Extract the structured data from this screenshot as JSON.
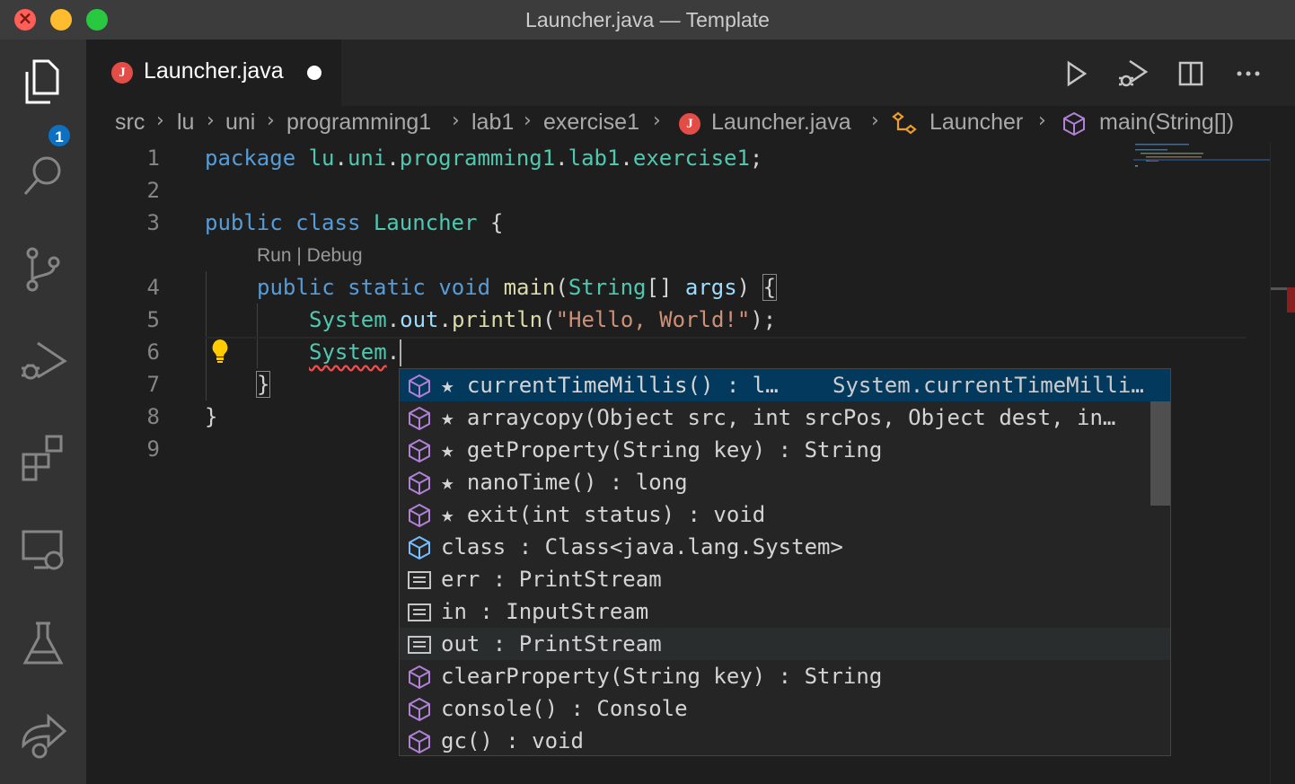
{
  "window": {
    "title": "Launcher.java — Template"
  },
  "activity_bar": {
    "explorer_badge": "1"
  },
  "tab": {
    "label": "Launcher.java",
    "file_icon": "J"
  },
  "breadcrumbs": {
    "items": [
      "src",
      "lu",
      "uni",
      "programming1",
      "lab1",
      "exercise1",
      "Launcher.java",
      "Launcher",
      "main(String[])"
    ]
  },
  "editor": {
    "line_numbers": [
      "1",
      "2",
      "3",
      "4",
      "5",
      "6",
      "7",
      "8",
      "9"
    ],
    "codelens": "Run | Debug",
    "lines": {
      "l1": {
        "kw": "package",
        "pkg_lu": "lu",
        "pkg_uni": "uni",
        "pkg_p": "programming1",
        "pkg_lab": "lab1",
        "pkg_ex": "exercise1",
        "end": ";"
      },
      "l3": {
        "kw1": "public",
        "kw2": "class",
        "name": "Launcher",
        "brace": "{"
      },
      "l4": {
        "kw1": "public",
        "kw2": "static",
        "kw3": "void",
        "fn": "main",
        "type": "String",
        "arr": "[]",
        "arg": "args",
        "close": ")",
        "brace": "{"
      },
      "l5": {
        "cls": "System",
        "field": "out",
        "fn": "println",
        "str": "\"Hello, World!\"",
        "end": ");"
      },
      "l6": {
        "cls": "System",
        "dot": "."
      },
      "l7": {
        "brace": "}"
      },
      "l8": {
        "brace": "}"
      }
    }
  },
  "suggestions": [
    {
      "label": "★ currentTimeMillis() : l…",
      "detail": "System.currentTimeMilli…",
      "icon": "method-icon"
    },
    {
      "label": "★ arraycopy(Object src, int srcPos, Object dest, in…",
      "detail": "",
      "icon": "method-icon"
    },
    {
      "label": "★ getProperty(String key) : String",
      "detail": "",
      "icon": "method-icon"
    },
    {
      "label": "★ nanoTime() : long",
      "detail": "",
      "icon": "method-icon"
    },
    {
      "label": "★ exit(int status) : void",
      "detail": "",
      "icon": "method-icon"
    },
    {
      "label": "class : Class<java.lang.System>",
      "detail": "",
      "icon": "class-icon"
    },
    {
      "label": "err : PrintStream",
      "detail": "",
      "icon": "field-icon"
    },
    {
      "label": "in : InputStream",
      "detail": "",
      "icon": "field-icon"
    },
    {
      "label": "out : PrintStream",
      "detail": "",
      "icon": "field-icon"
    },
    {
      "label": "clearProperty(String key) : String",
      "detail": "",
      "icon": "method-icon"
    },
    {
      "label": "console() : Console",
      "detail": "",
      "icon": "method-icon"
    },
    {
      "label": "gc() : void",
      "detail": "",
      "icon": "method-icon"
    }
  ],
  "colors": {
    "accent": "#0e70c0",
    "selection": "#04395e",
    "error": "#f14c4c",
    "method_icon": "#b180d7",
    "class_icon": "#75beff"
  }
}
